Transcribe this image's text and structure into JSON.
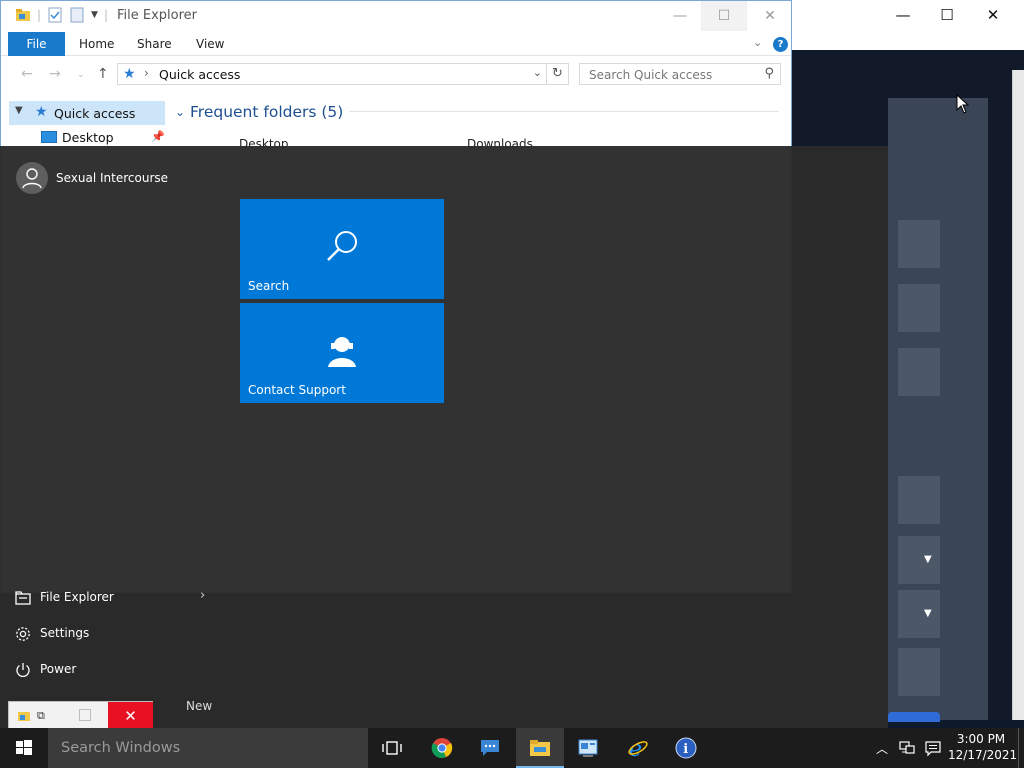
{
  "background_window": {
    "minimize": "—",
    "maximize": "☐",
    "close": "✕"
  },
  "file_explorer": {
    "title": "File Explorer",
    "minimize": "—",
    "maximize": "☐",
    "close": "✕",
    "ribbon_tabs": [
      "File",
      "Home",
      "Share",
      "View"
    ],
    "help": "?",
    "address": "Quick access",
    "search_placeholder": "Search Quick access",
    "sidebar": {
      "quick_access": "Quick access",
      "desktop": "Desktop"
    },
    "frequent_folders": "Frequent folders (5)",
    "folders": [
      "Desktop",
      "Downloads"
    ]
  },
  "start_menu": {
    "user_name": "Sexual Intercourse",
    "tiles": [
      {
        "label": "Search",
        "icon": "search-icon"
      },
      {
        "label": "Contact Support",
        "icon": "contact-support-icon"
      }
    ],
    "links": [
      {
        "label": "File Explorer",
        "icon": "file-explorer-icon"
      },
      {
        "label": "Settings",
        "icon": "gear-icon"
      },
      {
        "label": "Power",
        "icon": "power-icon"
      }
    ],
    "new_label": "New"
  },
  "taskbar": {
    "search_placeholder": "Search Windows",
    "apps": [
      "task-view",
      "chrome",
      "messaging",
      "file-explorer",
      "control-panel",
      "internet-explorer",
      "info"
    ],
    "time": "3:00 PM",
    "date": "12/17/2021"
  },
  "colors": {
    "accent": "#0078d7",
    "start_menu_bg": "#2b2b2b",
    "taskbar_bg": "#1c1c1c",
    "close_red": "#e81123"
  }
}
